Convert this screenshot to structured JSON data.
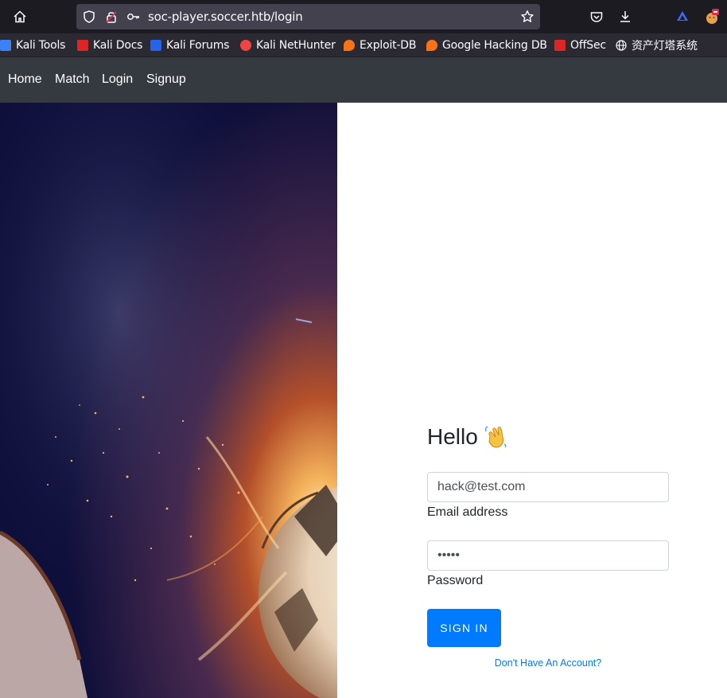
{
  "browser": {
    "url": "soc-player.soccer.htb/login",
    "icons": [
      "home-icon",
      "shield-icon",
      "insecure-lock-icon",
      "key-icon",
      "star-icon",
      "pocket-icon",
      "download-icon",
      "extension-icon",
      "profile-icon"
    ]
  },
  "bookmarks": [
    {
      "label": "Kali Tools",
      "icon": "kali-icon",
      "color": "#3b82f6"
    },
    {
      "label": "Kali Docs",
      "icon": "kali-docs-icon",
      "color": "#dc2626"
    },
    {
      "label": "Kali Forums",
      "icon": "kali-forums-icon",
      "color": "#2563eb"
    },
    {
      "label": "Kali NetHunter",
      "icon": "nethunter-icon",
      "color": "#ef4444"
    },
    {
      "label": "Exploit-DB",
      "icon": "exploit-db-icon",
      "color": "#f97316"
    },
    {
      "label": "Google Hacking DB",
      "icon": "ghdb-icon",
      "color": "#f97316"
    },
    {
      "label": "OffSec",
      "icon": "offsec-icon",
      "color": "#dc2626"
    },
    {
      "label": "资产灯塔系统",
      "icon": "globe-icon",
      "color": "#fbfbfe"
    }
  ],
  "nav": {
    "home": "Home",
    "match": "Match",
    "login": "Login",
    "signup": "Signup"
  },
  "login": {
    "greeting": "Hello",
    "greeting_emoji": "waving-hand-icon",
    "email_value": "hack@test.com",
    "email_label": "Email address",
    "password_value": "•••••",
    "password_label": "Password",
    "submit": "SIGN IN",
    "signup_link": "Don't Have An Account?"
  },
  "colors": {
    "navbar": "#343a40",
    "primary": "#007bff",
    "toolbar": "#1c1b22",
    "bookmarks": "#2b2a33"
  }
}
